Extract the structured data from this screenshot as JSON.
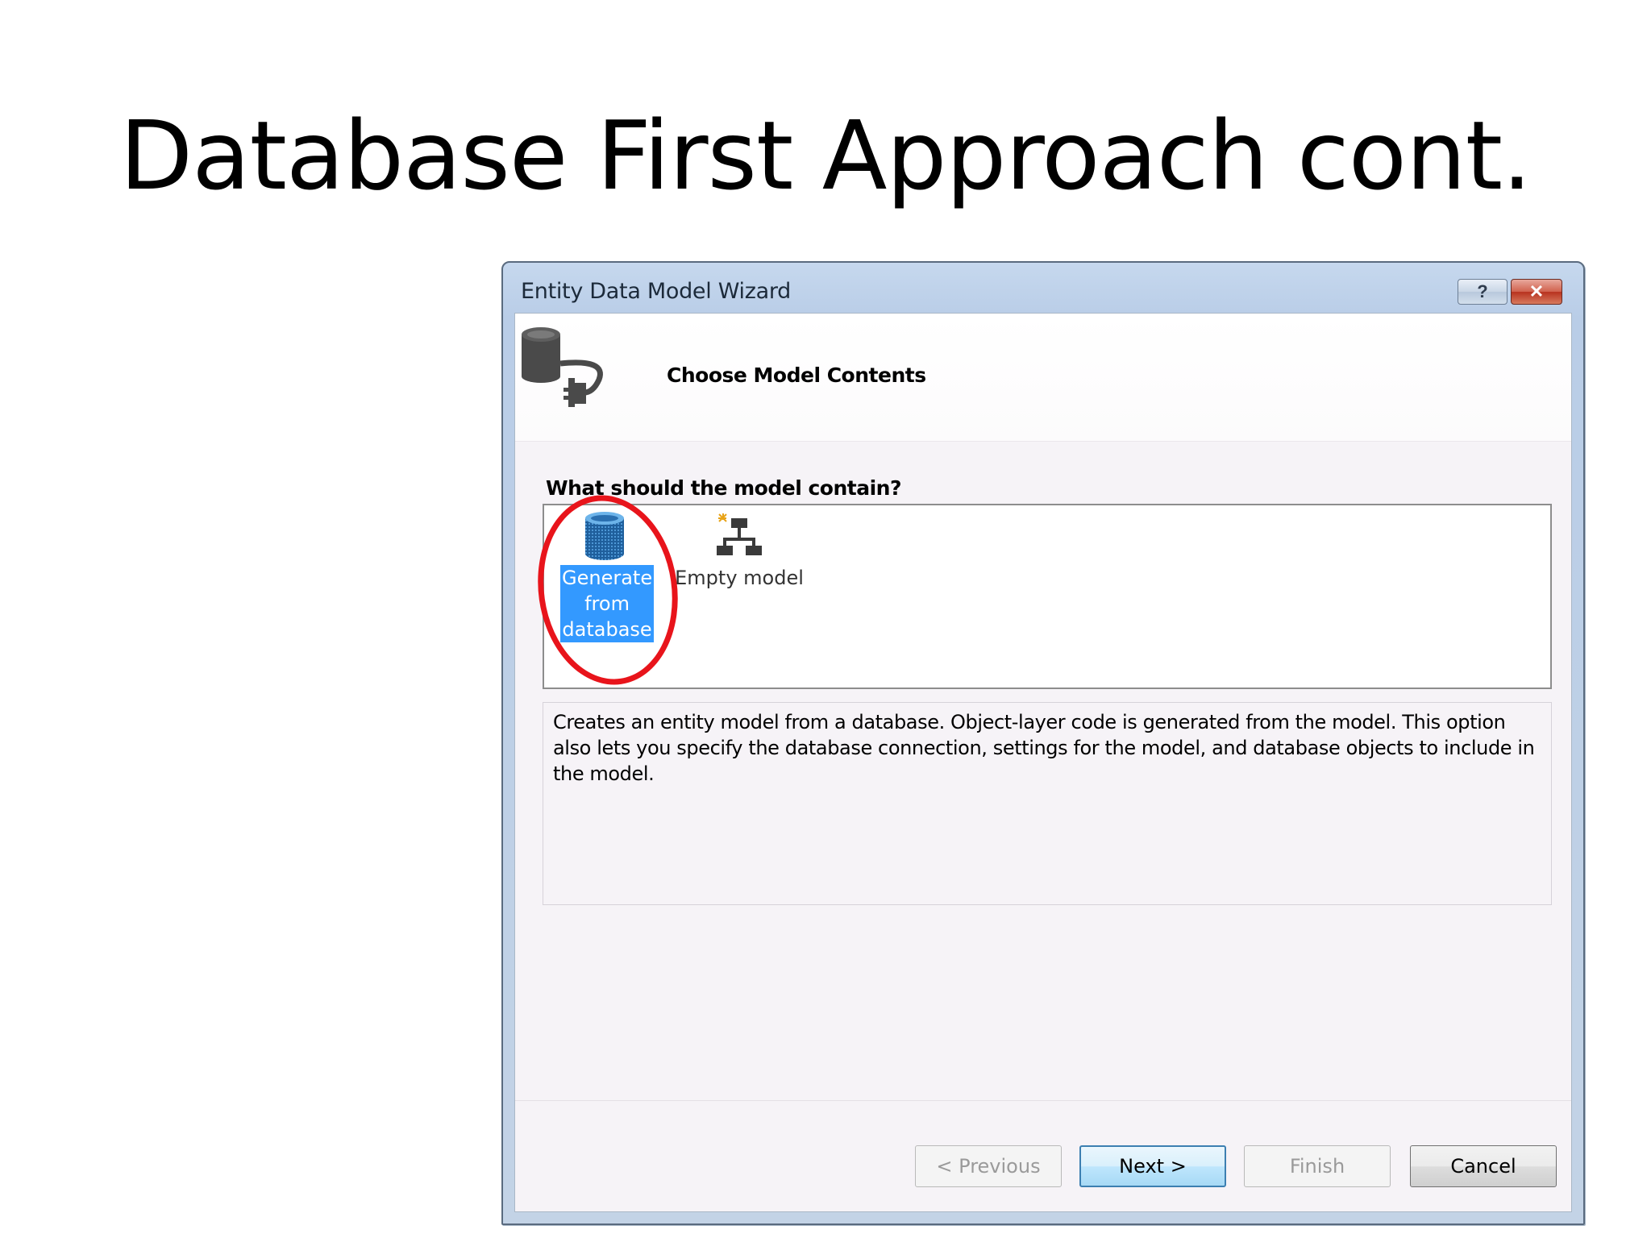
{
  "slide": {
    "title": "Database First Approach cont."
  },
  "dialog": {
    "title": "Entity Data Model Wizard",
    "help_label": "?",
    "close_label": "✕",
    "header_title": "Choose Model Contents",
    "question": "What should the model contain?",
    "options": [
      {
        "label_lines": [
          "Generate",
          "from",
          "database"
        ],
        "icon": "database-icon",
        "selected": true
      },
      {
        "label": "Empty model",
        "icon": "empty-model-icon",
        "selected": false
      }
    ],
    "description": "Creates an entity model from a database. Object-layer code is generated from the model. This option also lets you specify the database connection, settings for the model, and database objects to include in the model.",
    "buttons": {
      "previous": "< Previous",
      "next": "Next >",
      "finish": "Finish",
      "cancel": "Cancel"
    },
    "colors": {
      "selection": "#3399ff",
      "annotation_ring": "#e8141b",
      "close_button": "#c7432f"
    }
  }
}
